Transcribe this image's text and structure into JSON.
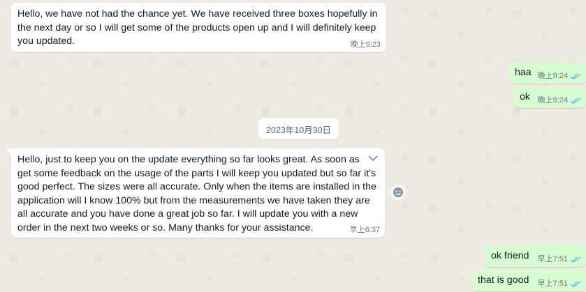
{
  "date_divider": "2023年10月30日",
  "messages": [
    {
      "direction": "incoming",
      "text": "Hello, we have not had the chance yet. We have received three boxes hopefully in\nthe next day or so I will get some of the products open up and I will definitely keep\nyou updated.",
      "time": "晚上9:23"
    },
    {
      "direction": "outgoing",
      "text": "haa",
      "time": "晚上9:24",
      "status": "read"
    },
    {
      "direction": "outgoing",
      "text": "ok",
      "time": "晚上9:24",
      "status": "read"
    },
    {
      "direction": "incoming",
      "text": "Hello, just to keep you on the update everything so far looks great. As soon as\nget some feedback on the usage of the parts I will keep you updated but so far it's\ngood perfect. The sizes were all accurate. Only when the items are installed in the\napplication will I know 100% but from the measurements we have taken they are\nall accurate and you have done a great job so far. I will update you with a new\norder in the next two weeks or so. Many thanks for your assistance.",
      "time": "早上6:37"
    },
    {
      "direction": "outgoing",
      "text": "ok friend",
      "time": "早上7:51",
      "status": "read"
    },
    {
      "direction": "outgoing",
      "text": "that is good",
      "time": "早上7:51",
      "status": "read"
    }
  ],
  "colors": {
    "background": "#efeae2",
    "incoming_bubble": "#ffffff",
    "outgoing_bubble": "#d9fdd3",
    "read_ticks": "#53bdeb",
    "meta_text": "#667781"
  },
  "icons": {
    "read_status": "double-check-icon",
    "message_menu": "chevron-down-icon",
    "react": "emoji-smile-icon"
  }
}
